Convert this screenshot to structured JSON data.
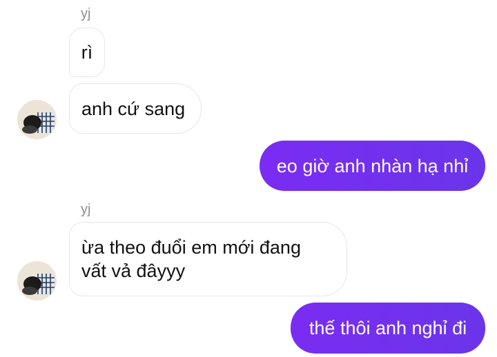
{
  "messages": [
    {
      "sender": "yj"
    },
    {
      "text": "rì"
    },
    {
      "text": "anh cứ sang"
    },
    {
      "text": "eo giờ anh nhàn hạ nhỉ"
    },
    {
      "sender": "yj"
    },
    {
      "line1": "ừa theo đuổi em mới đang",
      "line2": "vất vả đâyyy"
    },
    {
      "text": "thế thôi anh nghỉ đi"
    }
  ],
  "colors": {
    "outgoing": "#7a2cf2",
    "incoming_border": "#e6e6e6",
    "sender": "#8e8e8e"
  },
  "icons": [
    "avatar-icon"
  ]
}
